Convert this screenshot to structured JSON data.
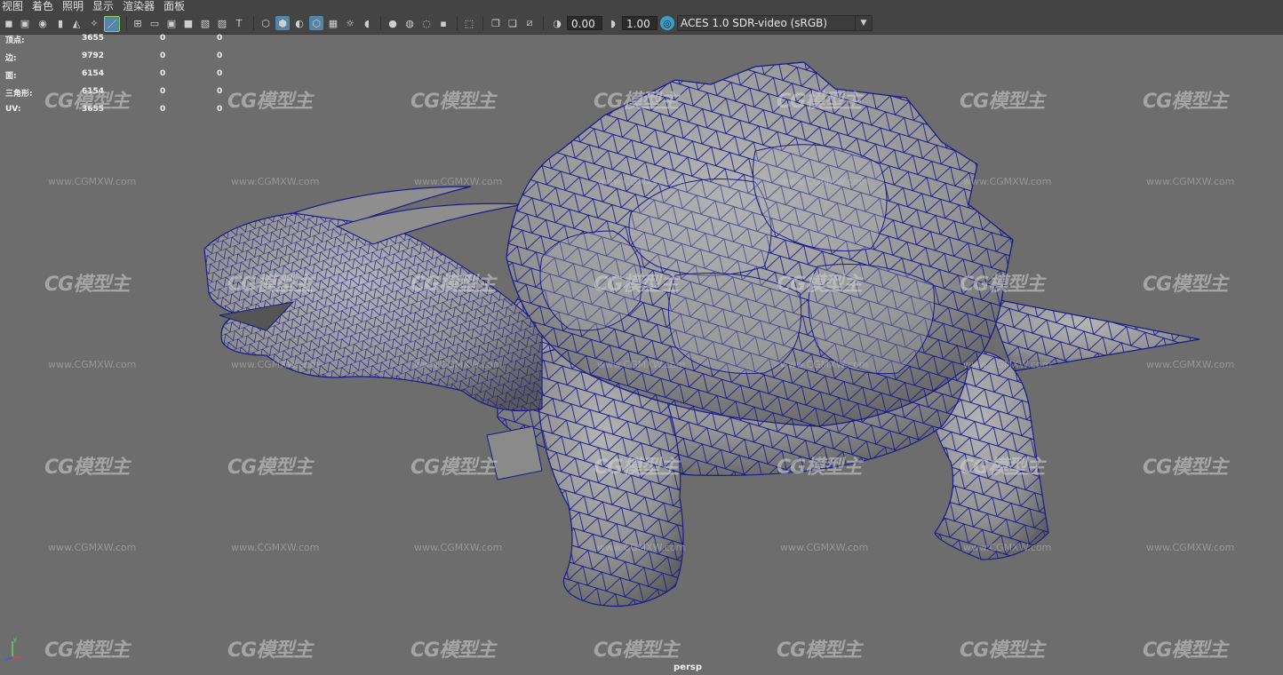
{
  "menubar": {
    "items": [
      "视图",
      "着色",
      "照明",
      "显示",
      "渲染器",
      "面板"
    ]
  },
  "toolbar": {
    "exposure_value": "0.00",
    "gamma_value": "1.00",
    "color_space": "ACES 1.0 SDR-video (sRGB)"
  },
  "hud": {
    "rows": [
      {
        "label": "顶点:",
        "values": [
          "3655",
          "0",
          "0"
        ]
      },
      {
        "label": "边:",
        "values": [
          "9792",
          "0",
          "0"
        ]
      },
      {
        "label": "面:",
        "values": [
          "6154",
          "0",
          "0"
        ]
      },
      {
        "label": "三角形:",
        "values": [
          "6154",
          "0",
          "0"
        ]
      },
      {
        "label": "UV:",
        "values": [
          "3655",
          "0",
          "0"
        ]
      }
    ]
  },
  "watermark": {
    "logo": "CG模型主",
    "url": "www.CGMXW.com"
  },
  "viewport": {
    "camera": "persp"
  },
  "colors": {
    "wire": "#1a1a8c",
    "mesh": "#9a9a9a",
    "background": "#6d6d6d"
  }
}
